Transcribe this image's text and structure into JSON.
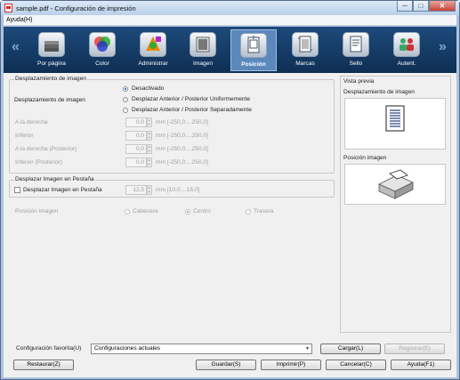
{
  "window": {
    "title": "sample.pdf - Configuración de impresión",
    "minimize": "─",
    "maximize": "□",
    "close": "✕"
  },
  "menu": {
    "help": "Ayuda(H)"
  },
  "toolbar": {
    "prev_arrow": "«",
    "next_arrow": "»",
    "tabs": [
      {
        "label": "Por página",
        "icon": "pages-stack-icon"
      },
      {
        "label": "Color",
        "icon": "color-circles-icon"
      },
      {
        "label": "Administrar",
        "icon": "manage-color-wheel-icon"
      },
      {
        "label": "Imagen",
        "icon": "image-frame-icon"
      },
      {
        "label": "Posición",
        "icon": "position-page-icon",
        "active": true
      },
      {
        "label": "Marcas",
        "icon": "marks-page-icon"
      },
      {
        "label": "Sello",
        "icon": "stamp-document-icon"
      },
      {
        "label": "Autent.",
        "icon": "authentication-users-icon"
      }
    ]
  },
  "image_shift": {
    "title": "Desplazamiento de imagen",
    "label": "Desplazamiento de imagen",
    "options": [
      {
        "label": "Desactivado",
        "selected": true
      },
      {
        "label": "Desplazar Anterior / Posterior Uniformemente",
        "selected": false
      },
      {
        "label": "Desplazar Anterior / Posterior Separadamente",
        "selected": false
      }
    ],
    "fields": [
      {
        "label": "A la derecha",
        "value": "0,0",
        "unit": "mm [-250,0....250,0]"
      },
      {
        "label": "Inferior",
        "value": "0,0",
        "unit": "mm [-250,0....250,0]"
      },
      {
        "label": "A la derecha (Posterior)",
        "value": "0,0",
        "unit": "mm [-250,0....250,0]"
      },
      {
        "label": "Inferior (Posterior)",
        "value": "0,0",
        "unit": "mm [-250,0....250,0]"
      }
    ]
  },
  "tab_shift": {
    "title": "Desplazar Imagen en Pestaña",
    "checkbox_label": "Desplazar Imagen en Pestaña",
    "checked": false,
    "value": "12,5",
    "unit": "mm [10,0....15,0]"
  },
  "image_position": {
    "label": "Posición imagen",
    "options": [
      {
        "label": "Cabecera",
        "selected": false
      },
      {
        "label": "Centro",
        "selected": true
      },
      {
        "label": "Trasera",
        "selected": false
      }
    ]
  },
  "preview": {
    "title": "Vista previa",
    "shift_label": "Desplazamiento de imagen",
    "position_label": "Posición imagen"
  },
  "footer": {
    "favorites_label": "Configuración favorita(U)",
    "favorites_value": "Configuraciones actuales",
    "load": "Cargar(L)",
    "register": "Registrar(E)",
    "restore": "Restaurar(Z)",
    "save": "Guardar(S)",
    "print": "Imprimir(P)",
    "cancel": "Cancelar(C)",
    "help": "Ayuda(F1)"
  },
  "colors": {
    "toolbar_bg": "#0f2f54",
    "active_tab": "#5c88bb",
    "frame": "#a9c4e0",
    "radio_selected": "#1f57b7"
  }
}
